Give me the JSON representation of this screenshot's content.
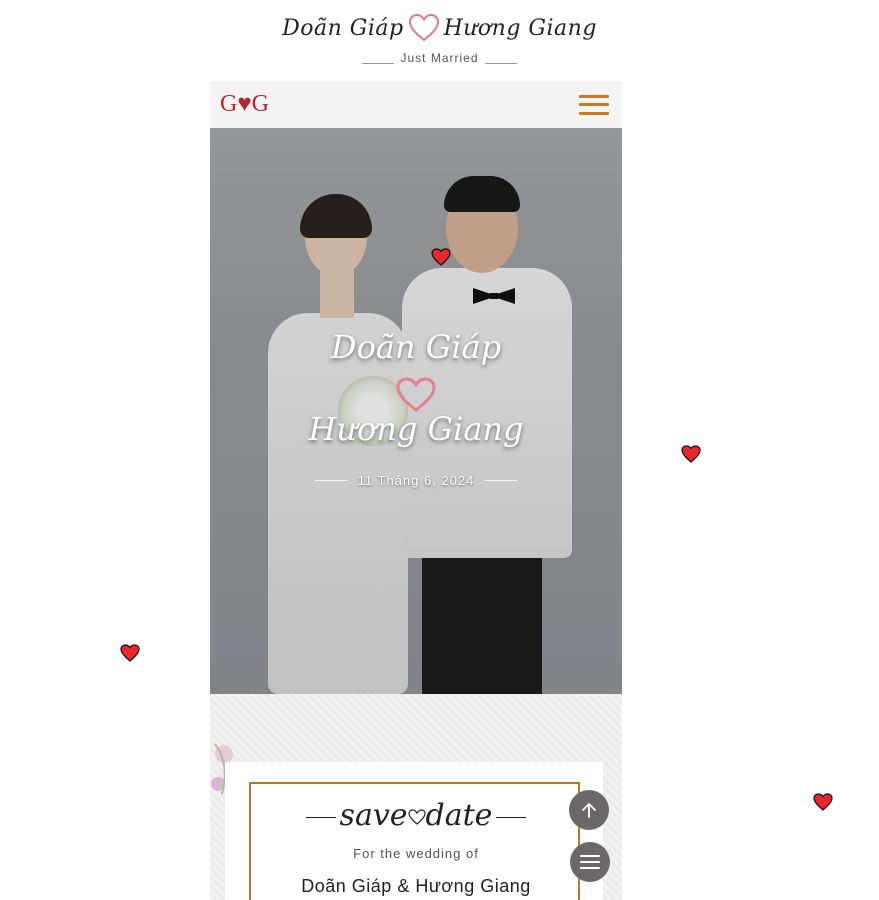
{
  "header": {
    "name_groom": "Doãn Giáp",
    "name_bride": "Hương Giang",
    "tagline": "Just Married"
  },
  "navbar": {
    "logo": "G♥G",
    "menu_icon": "hamburger-icon"
  },
  "hero": {
    "name_groom": "Doãn Giáp",
    "name_bride": "Hương Giang",
    "date": "11 Tháng 6, 2024"
  },
  "save_the_date": {
    "title_left": "save",
    "title_right": "date",
    "subtitle": "For the wedding of",
    "couple": "Doãn Giáp & Hương Giang"
  },
  "buttons": {
    "scroll_top_icon": "arrow-up-icon",
    "menu_icon": "menu-icon"
  },
  "colors": {
    "accent_gold": "#c77b26",
    "logo_red": "#b3262e",
    "heart_pink": "#e07a86",
    "fab_gray": "#6c6869"
  }
}
